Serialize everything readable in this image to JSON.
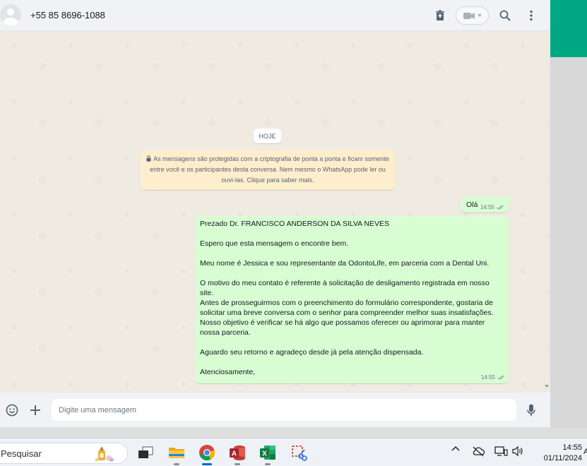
{
  "chat": {
    "contact_name": "+55 85 8696-1088",
    "date_divider": "HOJE",
    "encryption_notice": "As mensagens são protegidas com a criptografia de ponta a ponta e ficam somente entre você e os participantes desta conversa. Nem mesmo o WhatsApp pode ler ou ouvi-las. Clique para saber mais.",
    "messages": [
      {
        "direction": "outgoing",
        "text": "Olá",
        "time": "14:55",
        "status": "read"
      },
      {
        "direction": "outgoing",
        "paragraphs": [
          "Prezado Dr. FRANCISCO ANDERSON DA SILVA NEVES",
          "",
          "Espero que esta mensagem o encontre bem.",
          "",
          "Meu nome é Jessica e sou representante da OdontoLife, em parceria com a Dental Uni.",
          "",
          "O motivo do meu contato é referente à solicitação de desligamento registrada em nosso site.",
          "Antes de prosseguirmos com o preenchimento do formulário correspondente, gostaria de solicitar uma breve conversa com o senhor para compreender melhor suas insatisfações.",
          "Nosso objetivo é verificar se há algo que possamos oferecer ou aprimorar para manter nossa parceria.",
          "",
          "Aguardo seu retorno e agradeço desde já pela atenção dispensada.",
          "",
          "Atenciosamente,"
        ],
        "time": "14:55",
        "status": "read"
      }
    ]
  },
  "compose": {
    "placeholder": "Digite uma mensagem"
  },
  "icons": {
    "header": [
      "delete-icon",
      "video-call-icon",
      "chevron-down-icon",
      "search-icon",
      "menu-icon"
    ],
    "compose": [
      "emoji-icon",
      "plus-icon",
      "mic-icon"
    ],
    "message_status": "double-check-icon"
  },
  "taskbar": {
    "search_label": "Pesquisar",
    "apps": [
      "task-view",
      "file-explorer",
      "chrome",
      "access",
      "excel",
      "snipping-tool"
    ],
    "time": "14:55",
    "date": "01/11/2024",
    "edge_char": "A"
  },
  "colors": {
    "outgoing_bubble": "#d9fdd3",
    "notice_bg": "#ffeecd",
    "accent": "#00a884",
    "chat_bg": "#efeae2"
  }
}
